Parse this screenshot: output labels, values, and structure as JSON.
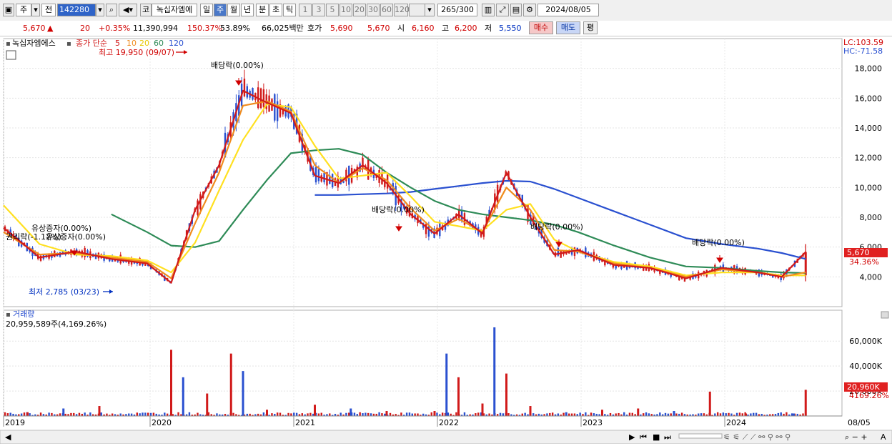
{
  "toolbar": {
    "market": "주",
    "prev_label": "전",
    "code": "142280",
    "name": "녹십자엠에",
    "period_tabs": [
      "일",
      "주",
      "월",
      "년",
      "분",
      "초",
      "틱"
    ],
    "active_tab": "주",
    "counts": [
      "1",
      "3",
      "5",
      "10",
      "20",
      "30",
      "60",
      "120"
    ],
    "bar_count": "265",
    "bar_total": "/300",
    "date": "2024/08/05"
  },
  "quote": {
    "price": "5,670",
    "change_arrow": "▲",
    "change": "20",
    "change_pct": "+0.35%",
    "volume": "11,390,994",
    "volume_ratio": "150.37%",
    "turnover": "53.89%",
    "amount": "66,025백만",
    "ask_label": "호가",
    "ask": "5,690",
    "bid": "5,670",
    "open_label": "시",
    "open": "6,160",
    "high_label": "고",
    "high": "6,200",
    "low_label": "저",
    "low": "5,550",
    "buy_label": "매수",
    "sell_label": "매도",
    "eval_label": "평"
  },
  "price_panel": {
    "stock_name": "녹십자엠에스",
    "ma_title": "종가 단순",
    "ma_periods": [
      "5",
      "10",
      "20",
      "60",
      "120"
    ],
    "ma_colors": [
      "#d11a1a",
      "#f08c1e",
      "#ffe020",
      "#2e8b57",
      "#2a50d0"
    ],
    "lc_label": "LC:103.59",
    "hc_label": "HC:-71.58",
    "current_tag": "5,670",
    "current_tag_pct": "34.36%",
    "high_label": "최고 19,950 (09/07)",
    "low_label": "최저 2,785 (03/23)",
    "events": [
      "배당락(0.00%)",
      "배당락(0.00%)",
      "배당락(0.00%)",
      "배당락(0.00%)",
      "유상증자(0.00%)",
      "권리락(-1.12%)",
      "유상증자(0.00%)"
    ]
  },
  "volume_panel": {
    "title": "거래량",
    "summary": "20,959,589주(4,169.26%)",
    "current_tag": "20,960K",
    "current_tag_pct": "4169.26%"
  },
  "x_axis": {
    "labels": [
      "2019",
      "2020",
      "2021",
      "2022",
      "2023",
      "2024"
    ],
    "last_date": "08/05"
  },
  "chart_data": [
    {
      "type": "line",
      "title": "녹십자엠에스 주봉 · 종가 단순 이동평균",
      "x": [
        "2019-01",
        "2019-04",
        "2019-07",
        "2019-10",
        "2020-01",
        "2020-03",
        "2020-05",
        "2020-07",
        "2020-09",
        "2020-11",
        "2021-01",
        "2021-03",
        "2021-05",
        "2021-07",
        "2021-09",
        "2021-11",
        "2022-01",
        "2022-03",
        "2022-05",
        "2022-07",
        "2022-09",
        "2022-11",
        "2023-01",
        "2023-04",
        "2023-07",
        "2023-10",
        "2024-01",
        "2024-04",
        "2024-06",
        "2024-08"
      ],
      "series": [
        {
          "name": "5",
          "values": [
            7300,
            5300,
            5700,
            5200,
            4900,
            3600,
            8500,
            11500,
            16500,
            15700,
            15000,
            10800,
            10300,
            11500,
            10300,
            8200,
            6900,
            8200,
            6900,
            11000,
            8000,
            5500,
            5800,
            4800,
            4600,
            3900,
            4600,
            4300,
            4000,
            5670
          ]
        },
        {
          "name": "10",
          "values": [
            7000,
            5500,
            5600,
            5300,
            5000,
            3900,
            7600,
            11000,
            15500,
            15800,
            15100,
            11500,
            10300,
            11300,
            10500,
            8600,
            7100,
            7900,
            7000,
            10000,
            8500,
            5800,
            5700,
            4900,
            4600,
            4000,
            4500,
            4300,
            4000,
            4300
          ]
        },
        {
          "name": "20",
          "values": [
            8800,
            6200,
            5500,
            5400,
            5100,
            4300,
            6300,
            9800,
            13200,
            15600,
            15400,
            12800,
            10600,
            10800,
            11000,
            9400,
            7700,
            7400,
            7100,
            8500,
            8900,
            6500,
            5700,
            5000,
            4700,
            4100,
            4300,
            4300,
            4100,
            4100
          ]
        },
        {
          "name": "60",
          "values": [
            null,
            null,
            null,
            8200,
            7000,
            6100,
            6000,
            6400,
            8500,
            10500,
            12300,
            12500,
            12600,
            12200,
            11000,
            10000,
            9100,
            8500,
            8200,
            8000,
            7800,
            7500,
            7000,
            6100,
            5300,
            4700,
            4600,
            4400,
            4300,
            4250
          ]
        },
        {
          "name": "120",
          "values": [
            null,
            null,
            null,
            null,
            null,
            null,
            null,
            null,
            null,
            null,
            null,
            9500,
            9500,
            9550,
            9600,
            9700,
            9900,
            10100,
            10300,
            10450,
            10400,
            9900,
            9300,
            8400,
            7500,
            6600,
            6200,
            5900,
            5600,
            5200
          ]
        }
      ],
      "ylim": [
        2000,
        20000
      ],
      "y_ticks": [
        4000,
        6000,
        8000,
        10000,
        12000,
        14000,
        16000,
        18000
      ],
      "y_tick_labels": [
        "4,000",
        "6,000",
        "8,000",
        "10,000",
        "12,000",
        "14,000",
        "16,000",
        "18,000"
      ],
      "grid": true
    },
    {
      "type": "bar",
      "title": "거래량",
      "x": [
        "2019-03",
        "2019-06",
        "2019-09",
        "2020-03",
        "2020-04",
        "2020-06",
        "2020-08",
        "2020-09",
        "2020-11",
        "2021-03",
        "2021-06",
        "2021-09",
        "2022-01",
        "2022-02",
        "2022-03",
        "2022-05",
        "2022-06",
        "2022-07",
        "2022-09",
        "2022-12",
        "2023-03",
        "2023-06",
        "2023-09",
        "2023-12",
        "2024-03",
        "2024-07",
        "2024-08"
      ],
      "values": [
        3000,
        6000,
        8000,
        53000,
        31000,
        18000,
        50000,
        36000,
        5000,
        9000,
        6000,
        4000,
        4000,
        50000,
        31000,
        10000,
        71000,
        34000,
        8000,
        3000,
        5000,
        6000,
        4000,
        19500,
        2000,
        2000,
        20960
      ],
      "ylim": [
        0,
        75000
      ],
      "y_ticks": [
        20000,
        40000,
        60000
      ],
      "y_tick_labels": [
        "20,000K",
        "40,000K",
        "60,000K"
      ]
    }
  ]
}
